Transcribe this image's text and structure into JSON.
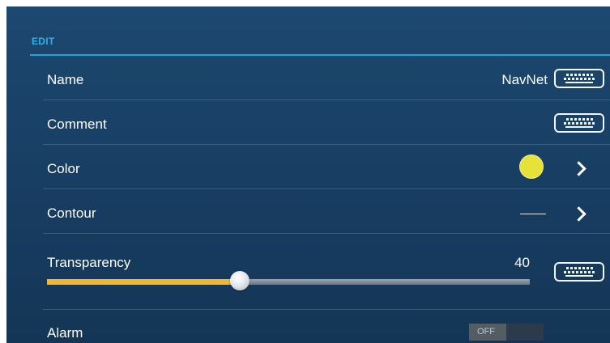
{
  "section": {
    "title": "EDIT"
  },
  "rows": {
    "name": {
      "label": "Name",
      "value": "NavNet",
      "keyboard_icon": "keyboard-icon"
    },
    "comment": {
      "label": "Comment",
      "keyboard_icon": "keyboard-icon"
    },
    "color": {
      "label": "Color",
      "swatch_color": "#e7e23a",
      "chevron_icon": "chevron-right-icon"
    },
    "contour": {
      "label": "Contour",
      "chevron_icon": "chevron-right-icon"
    },
    "transparency": {
      "label": "Transparency",
      "value": "40",
      "slider_fraction": 0.4,
      "keyboard_icon": "keyboard-icon"
    },
    "alarm": {
      "label": "Alarm",
      "toggle_label": "OFF",
      "toggle_state": "off"
    }
  },
  "colors": {
    "accent": "#20a6dc",
    "slider_fill": "#f2b72e",
    "background": "#183e63"
  }
}
